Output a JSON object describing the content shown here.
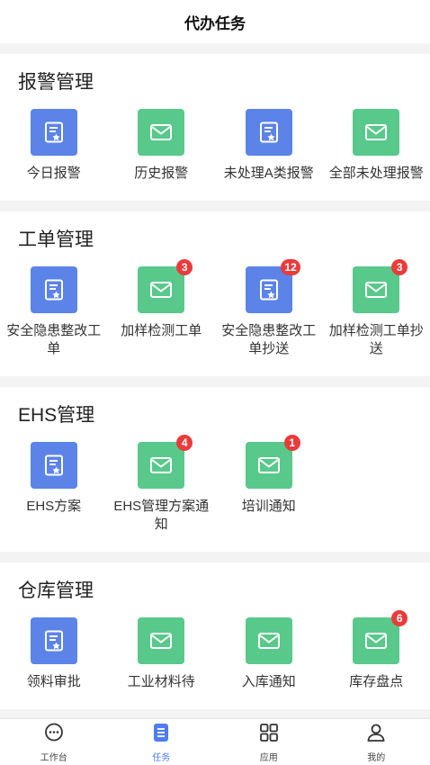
{
  "header": {
    "title": "代办任务"
  },
  "sections": [
    {
      "title": "报警管理",
      "items": [
        {
          "label": "今日报警",
          "color": "blue",
          "icon": "report-icon",
          "badge": ""
        },
        {
          "label": "历史报警",
          "color": "green",
          "icon": "mail-icon",
          "badge": ""
        },
        {
          "label": "未处理A类报警",
          "color": "blue",
          "icon": "report-icon",
          "badge": ""
        },
        {
          "label": "全部未处理报警",
          "color": "green",
          "icon": "mail-icon",
          "badge": ""
        }
      ]
    },
    {
      "title": "工单管理",
      "items": [
        {
          "label": "安全隐患整改工单",
          "color": "blue",
          "icon": "report-icon",
          "badge": ""
        },
        {
          "label": "加样检测工单",
          "color": "green",
          "icon": "mail-icon",
          "badge": "3"
        },
        {
          "label": "安全隐患整改工单抄送",
          "color": "blue",
          "icon": "report-icon",
          "badge": "12"
        },
        {
          "label": "加样检测工单抄送",
          "color": "green",
          "icon": "mail-icon",
          "badge": "3"
        }
      ]
    },
    {
      "title": "EHS管理",
      "items": [
        {
          "label": "EHS方案",
          "color": "blue",
          "icon": "report-icon",
          "badge": ""
        },
        {
          "label": "EHS管理方案通知",
          "color": "green",
          "icon": "mail-icon",
          "badge": "4"
        },
        {
          "label": "培训通知",
          "color": "green",
          "icon": "mail-icon",
          "badge": "1"
        }
      ]
    },
    {
      "title": "仓库管理",
      "items": [
        {
          "label": "领料审批",
          "color": "blue",
          "icon": "report-icon",
          "badge": ""
        },
        {
          "label": "工业材料待",
          "color": "green",
          "icon": "mail-icon",
          "badge": ""
        },
        {
          "label": "入库通知",
          "color": "green",
          "icon": "mail-icon",
          "badge": ""
        },
        {
          "label": "库存盘点",
          "color": "green",
          "icon": "mail-icon",
          "badge": "6"
        }
      ]
    }
  ],
  "tabbar": {
    "items": [
      {
        "label": "工作台",
        "icon": "chat-bubble-icon",
        "active": false
      },
      {
        "label": "任务",
        "icon": "task-list-icon",
        "active": true
      },
      {
        "label": "应用",
        "icon": "grid-apps-icon",
        "active": false
      },
      {
        "label": "我的",
        "icon": "user-icon",
        "active": false
      }
    ]
  },
  "colors": {
    "blue": "#5b83e8",
    "green": "#58c98a",
    "badge": "#e93b3b",
    "active": "#4f7cf0"
  }
}
